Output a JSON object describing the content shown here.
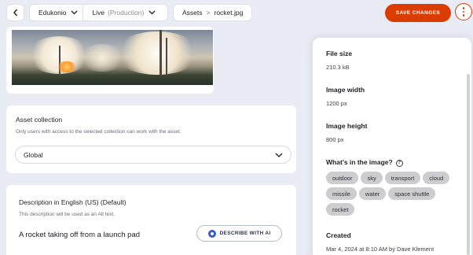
{
  "header": {
    "back_icon": "chevron-left-icon",
    "project": "Edukonio",
    "environment": "Live",
    "environment_sub": "(Production)",
    "breadcrumb": [
      "Assets",
      "rocket.jpg"
    ],
    "breadcrumb_separator": ">",
    "save_label": "SAVE CHANGES",
    "more_icon": "more-vertical-icon"
  },
  "colors": {
    "accent": "#db3c00",
    "background": "#e9ecf4",
    "card": "#ffffff",
    "tag": "#cdcdcf",
    "ai_icon": "#3a5bc9"
  },
  "collection": {
    "title": "Asset collection",
    "subtitle": "Only users with access to the selected collection can work with the asset.",
    "selected": "Global"
  },
  "description": {
    "title": "Description in English (US) (Default)",
    "subtitle": "This description will be used as an Alt text.",
    "value": "A rocket taking off from a launch pad",
    "ai_button": "DESCRIBE WITH AI"
  },
  "details": {
    "file_size_label": "File size",
    "file_size": "210.3 kB",
    "width_label": "Image width",
    "width": "1200 px",
    "height_label": "Image height",
    "height": "800 px",
    "tags_label": "What’s in the image?",
    "tags": [
      "outdoor",
      "sky",
      "transport",
      "cloud",
      "missile",
      "water",
      "space shuttle",
      "rocket"
    ],
    "created_label": "Created",
    "created": "Mar 4, 2024 at 8:10 AM by Dave Klement"
  }
}
